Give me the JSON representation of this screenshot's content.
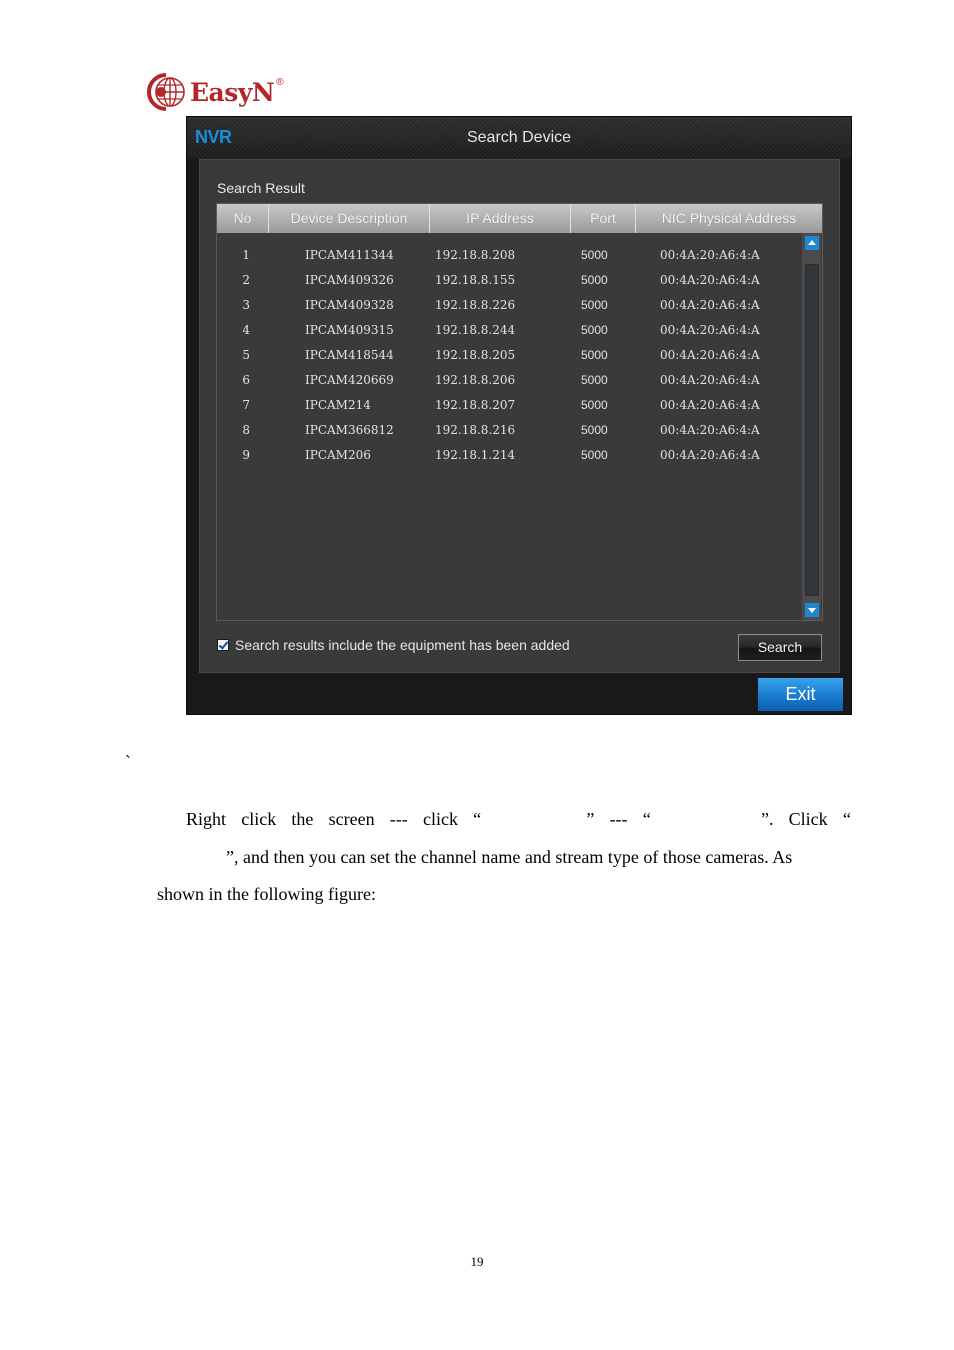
{
  "logo": {
    "brand": "EasyN",
    "registered": "®",
    "icon": "globe-logo-icon",
    "color": "#b4262b"
  },
  "window": {
    "brand": "NVR",
    "title": "Search Device",
    "section_label": "Search Result",
    "table": {
      "columns": [
        "No",
        "Device Description",
        "IP Address",
        "Port",
        "NIC Physical Address"
      ],
      "rows": [
        {
          "no": "1",
          "desc": "IPCAM411344",
          "ip": "192.18.8.208",
          "port": "5000",
          "mac": "00:4A:20:A6:4:A"
        },
        {
          "no": "2",
          "desc": "IPCAM409326",
          "ip": "192.18.8.155",
          "port": "5000",
          "mac": "00:4A:20:A6:4:A"
        },
        {
          "no": "3",
          "desc": "IPCAM409328",
          "ip": "192.18.8.226",
          "port": "5000",
          "mac": "00:4A:20:A6:4:A"
        },
        {
          "no": "4",
          "desc": "IPCAM409315",
          "ip": "192.18.8.244",
          "port": "5000",
          "mac": "00:4A:20:A6:4:A"
        },
        {
          "no": "5",
          "desc": "IPCAM418544",
          "ip": "192.18.8.205",
          "port": "5000",
          "mac": "00:4A:20:A6:4:A"
        },
        {
          "no": "6",
          "desc": "IPCAM420669",
          "ip": "192.18.8.206",
          "port": "5000",
          "mac": "00:4A:20:A6:4:A"
        },
        {
          "no": "7",
          "desc": "IPCAM214",
          "ip": "192.18.8.207",
          "port": "5000",
          "mac": "00:4A:20:A6:4:A"
        },
        {
          "no": "8",
          "desc": "IPCAM366812",
          "ip": "192.18.8.216",
          "port": "5000",
          "mac": "00:4A:20:A6:4:A"
        },
        {
          "no": "9",
          "desc": "IPCAM206",
          "ip": "192.18.1.214",
          "port": "5000",
          "mac": "00:4A:20:A6:4:A"
        }
      ]
    },
    "checkbox": {
      "label": "Search results include the equipment has been added",
      "checked": true
    },
    "search_button": "Search",
    "exit_button": "Exit",
    "colors": {
      "accent": "#1b8fd6",
      "button_blue": "#1a7fd0",
      "panel": "#3a3a3a",
      "frame": "#18191b"
    }
  },
  "document": {
    "stray_mark": "`",
    "paragraph": {
      "line1": [
        "Right",
        "click",
        "the",
        "screen",
        "---",
        "click",
        "“",
        "”",
        "---",
        "“",
        "”.",
        "Click",
        "“"
      ],
      "line2": "”, and then you can set the channel name and stream type of those cameras. As",
      "line3": "shown in the following figure:"
    },
    "page_number": "19"
  }
}
